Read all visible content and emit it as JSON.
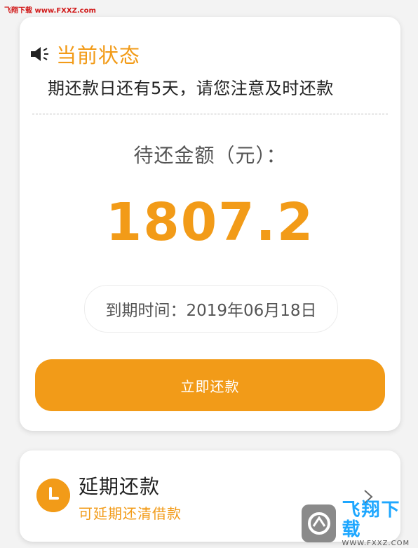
{
  "watermark_top": "飞翔下载 www.FXXZ.com",
  "status_card": {
    "title": "当前状态",
    "notice": "期还款日还有5天，请您注意及时还款",
    "amount_label": "待还金额（元）：",
    "amount": "1807.2",
    "due_date": "到期时间：2019年06月18日",
    "pay_button": "立即还款"
  },
  "extend_card": {
    "title": "延期还款",
    "subtitle": "可延期还清借款"
  },
  "watermark_logo": {
    "text": "飞翔下载",
    "url": "WWW.FXXZ.COM"
  },
  "icons": [
    "speaker-icon",
    "clock-icon",
    "chevron-right-icon"
  ],
  "colors": {
    "accent": "#f29b18",
    "background": "#f3f3f3",
    "card": "#ffffff"
  }
}
